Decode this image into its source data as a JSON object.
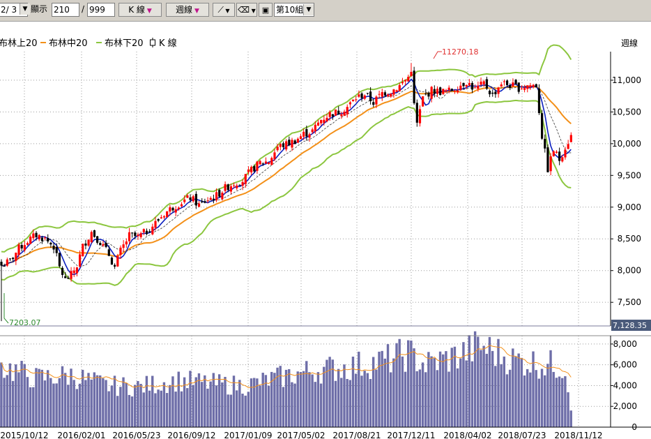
{
  "toolbar": {
    "page": "2/ 3",
    "display_label": "顯示",
    "display_value": "210",
    "slash": "/",
    "total_value": "999",
    "kline_label": "K 線",
    "period_label": "週線",
    "group_label": "第10組"
  },
  "legend": {
    "upper": "布林上20",
    "middle": "布林中20",
    "lower": "布林下20",
    "kline": "K 線"
  },
  "period_corner": "週線",
  "annotations": {
    "high_label": "11270.18",
    "low_label": "7203.07",
    "cursor_value": "7,128.35"
  },
  "colors": {
    "up": "#ff0000",
    "down": "#000000",
    "upper": "#8cc63f",
    "lower": "#8cc63f",
    "middle": "#f39019",
    "ma_fast": "#0b1fbf",
    "volume": "#6e6ea8",
    "volume_ma": "#f39019"
  },
  "chart_data": {
    "type": "candlestick",
    "x_ticks": [
      "2015/10/12",
      "2016/02/01",
      "2016/05/23",
      "2016/09/12",
      "2017/01/09",
      "2017/05/02",
      "2017/08/21",
      "2017/12/11",
      "2018/04/02",
      "2018/07/23",
      "2018/11/12"
    ],
    "y_ticks": [
      "7,500",
      "8,000",
      "8,500",
      "9,000",
      "9,500",
      "10,000",
      "10,500",
      "11,000"
    ],
    "ylim": [
      7128,
      11450
    ],
    "volume_ticks": [
      "0",
      "2,000",
      "4,000",
      "6,000",
      "8,000"
    ],
    "volume_ylim": [
      0,
      8800
    ],
    "high": 11270.18,
    "low": 7203.07,
    "close_anchors": [
      [
        0,
        8080
      ],
      [
        3,
        8150
      ],
      [
        6,
        8350
      ],
      [
        9,
        8470
      ],
      [
        12,
        8560
      ],
      [
        15,
        8500
      ],
      [
        18,
        8380
      ],
      [
        20,
        8050
      ],
      [
        22,
        7850
      ],
      [
        24,
        7930
      ],
      [
        26,
        8080
      ],
      [
        28,
        8380
      ],
      [
        31,
        8610
      ],
      [
        34,
        8450
      ],
      [
        37,
        8250
      ],
      [
        39,
        8050
      ],
      [
        41,
        8310
      ],
      [
        44,
        8550
      ],
      [
        47,
        8530
      ],
      [
        50,
        8620
      ],
      [
        53,
        8750
      ],
      [
        56,
        8900
      ],
      [
        59,
        9000
      ],
      [
        62,
        9080
      ],
      [
        65,
        9150
      ],
      [
        68,
        9030
      ],
      [
        71,
        9120
      ],
      [
        74,
        9180
      ],
      [
        77,
        9300
      ],
      [
        80,
        9380
      ],
      [
        83,
        9420
      ],
      [
        86,
        9580
      ],
      [
        89,
        9700
      ],
      [
        92,
        9720
      ],
      [
        95,
        9950
      ],
      [
        98,
        9990
      ],
      [
        101,
        10050
      ],
      [
        104,
        10150
      ],
      [
        107,
        10200
      ],
      [
        110,
        10380
      ],
      [
        113,
        10470
      ],
      [
        116,
        10500
      ],
      [
        119,
        10580
      ],
      [
        122,
        10720
      ],
      [
        125,
        10780
      ],
      [
        128,
        10650
      ],
      [
        131,
        10800
      ],
      [
        134,
        10830
      ],
      [
        137,
        10910
      ],
      [
        140,
        11050
      ],
      [
        141,
        11180
      ],
      [
        142,
        10600
      ],
      [
        143,
        10310
      ],
      [
        145,
        10720
      ],
      [
        148,
        10840
      ],
      [
        151,
        10820
      ],
      [
        154,
        10830
      ],
      [
        157,
        10900
      ],
      [
        160,
        10980
      ],
      [
        163,
        10850
      ],
      [
        166,
        10950
      ],
      [
        169,
        10760
      ],
      [
        172,
        10960
      ],
      [
        175,
        10920
      ],
      [
        178,
        10880
      ],
      [
        181,
        10920
      ],
      [
        184,
        10920
      ],
      [
        186,
        10120
      ],
      [
        188,
        9600
      ],
      [
        190,
        9900
      ],
      [
        192,
        9750
      ],
      [
        194,
        9950
      ],
      [
        196,
        10120
      ]
    ],
    "volume_anchors": [
      [
        0,
        5900
      ],
      [
        12,
        4700
      ],
      [
        24,
        5000
      ],
      [
        36,
        4000
      ],
      [
        48,
        3900
      ],
      [
        60,
        4500
      ],
      [
        72,
        4200
      ],
      [
        84,
        4000
      ],
      [
        96,
        4800
      ],
      [
        108,
        5500
      ],
      [
        120,
        5800
      ],
      [
        132,
        6400
      ],
      [
        140,
        7100
      ],
      [
        146,
        6000
      ],
      [
        156,
        6800
      ],
      [
        165,
        7800
      ],
      [
        176,
        6500
      ],
      [
        186,
        6100
      ],
      [
        194,
        5800
      ],
      [
        196,
        1600
      ]
    ],
    "series": [
      {
        "name": "布林上20"
      },
      {
        "name": "布林中20"
      },
      {
        "name": "布林下20"
      }
    ]
  }
}
